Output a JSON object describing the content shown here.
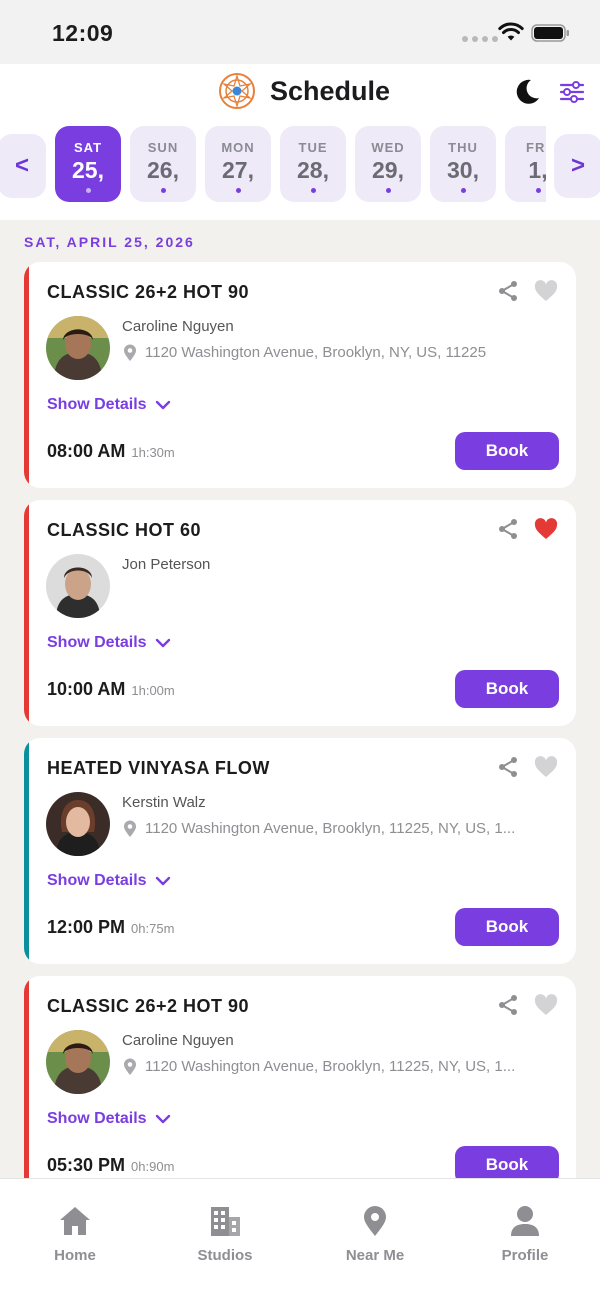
{
  "status_bar": {
    "time": "12:09"
  },
  "header": {
    "title": "Schedule"
  },
  "date_strip": {
    "prev_label": "<",
    "next_label": ">",
    "dates": [
      {
        "day": "SAT",
        "num": "25,",
        "active": true
      },
      {
        "day": "SUN",
        "num": "26,",
        "active": false
      },
      {
        "day": "MON",
        "num": "27,",
        "active": false
      },
      {
        "day": "TUE",
        "num": "28,",
        "active": false
      },
      {
        "day": "WED",
        "num": "29,",
        "active": false
      },
      {
        "day": "THU",
        "num": "30,",
        "active": false
      },
      {
        "day": "FRI",
        "num": "1,",
        "active": false
      }
    ]
  },
  "selected_date": "SAT, APRIL 25, 2026",
  "classes": [
    {
      "title": "CLASSIC 26+2 HOT 90",
      "instructor": "Caroline Nguyen",
      "address": "1120 Washington Avenue, Brooklyn, NY, US, 11225",
      "details_label": "Show Details",
      "time": "08:00 AM",
      "duration": "1h:30m",
      "book_label": "Book",
      "favorited": false,
      "accent_color": "#e53935"
    },
    {
      "title": "CLASSIC HOT 60",
      "instructor": "Jon Peterson",
      "address": "",
      "details_label": "Show Details",
      "time": "10:00 AM",
      "duration": "1h:00m",
      "book_label": "Book",
      "favorited": true,
      "accent_color": "#e53935"
    },
    {
      "title": "HEATED VINYASA FLOW",
      "instructor": "Kerstin Walz",
      "address": "1120 Washington Avenue, Brooklyn, 11225, NY, US, 1...",
      "details_label": "Show Details",
      "time": "12:00 PM",
      "duration": "0h:75m",
      "book_label": "Book",
      "favorited": false,
      "accent_color": "#0a8f9c"
    },
    {
      "title": "CLASSIC 26+2 HOT 90",
      "instructor": "Caroline Nguyen",
      "address": "1120 Washington Avenue, Brooklyn, 11225, NY, US, 1...",
      "details_label": "Show Details",
      "time": "05:30 PM",
      "duration": "0h:90m",
      "book_label": "Book",
      "favorited": false,
      "accent_color": "#e53935"
    }
  ],
  "tabs": [
    {
      "label": "Home",
      "icon": "home-icon"
    },
    {
      "label": "Studios",
      "icon": "building-icon"
    },
    {
      "label": "Near Me",
      "icon": "location-pin-icon"
    },
    {
      "label": "Profile",
      "icon": "person-icon"
    }
  ],
  "colors": {
    "accent": "#7a3ee0",
    "favorite": "#e53935",
    "inactive_icon": "#8e8e93"
  }
}
